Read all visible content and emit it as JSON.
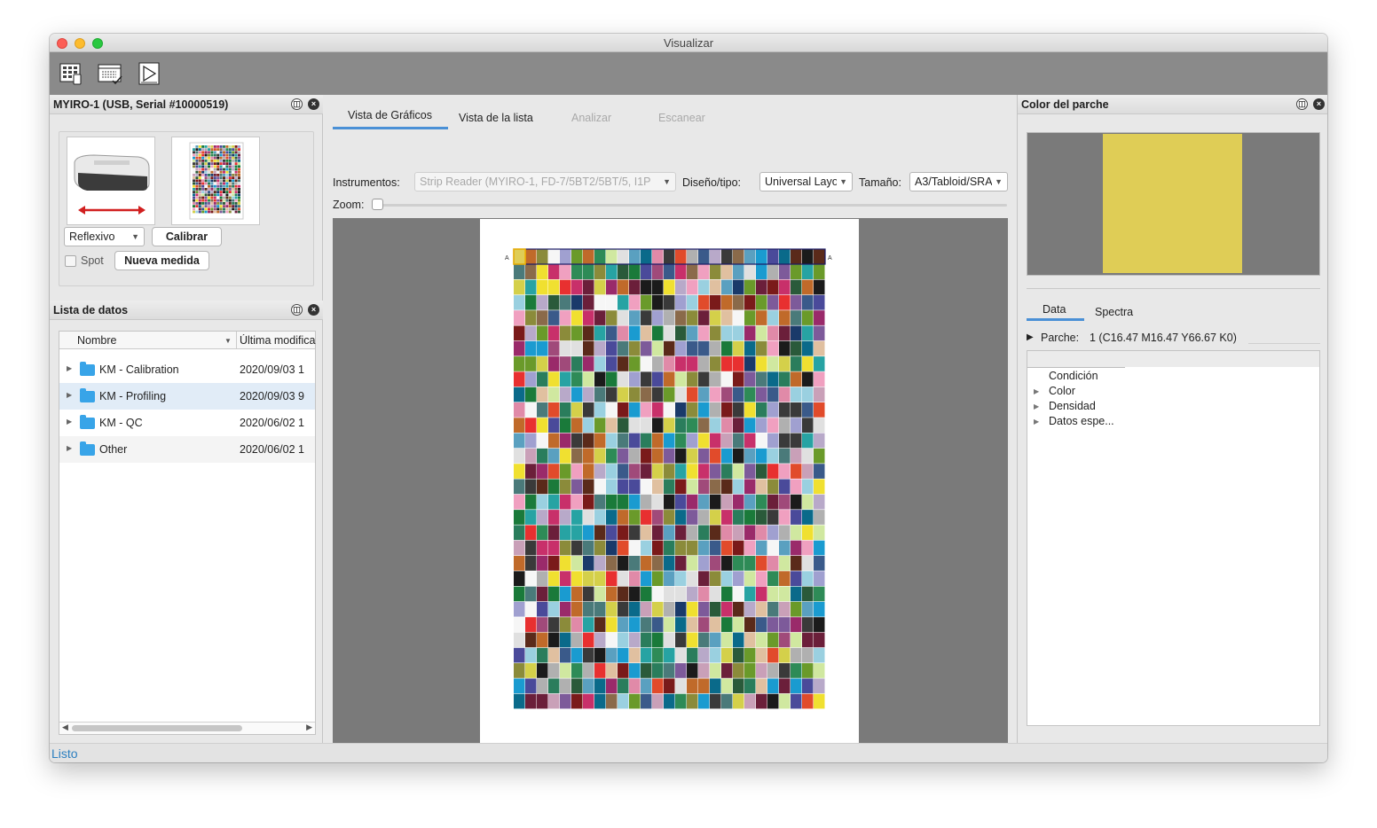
{
  "window": {
    "title": "Visualizar"
  },
  "toolbar": {
    "icons": [
      "chart-grid-icon",
      "list-view-icon",
      "play-chart-icon"
    ]
  },
  "instrument_panel": {
    "header": "MYIRO-1 (USB, Serial #10000519)",
    "mode_select": "Reflexivo",
    "calibrate_label": "Calibrar",
    "spot_label": "Spot",
    "new_measure_label": "Nueva medida"
  },
  "data_list": {
    "header": "Lista de datos",
    "columns": [
      "Nombre",
      "Última modifica"
    ],
    "rows": [
      {
        "name": "KM - Calibration",
        "date": "2020/09/03 1"
      },
      {
        "name": "KM - Profiling",
        "date": "2020/09/03 9"
      },
      {
        "name": "KM - QC",
        "date": "2020/06/02 1"
      },
      {
        "name": "Other",
        "date": "2020/06/02 1"
      }
    ]
  },
  "center": {
    "tabs": [
      "Vista de Gráficos",
      "Vista de la lista",
      "Analizar",
      "Escanear"
    ],
    "active_tab": "Vista de Gráficos",
    "instruments_label": "Instrumentos:",
    "instruments_value": "Strip Reader (MYIRO-1, FD-7/5BT2/5BT/5, I1P",
    "layout_label": "Diseño/tipo:",
    "layout_value": "Universal Layout",
    "size_label": "Tamaño:",
    "size_value": "A3/Tabloid/SRA",
    "zoom_label": "Zoom:",
    "row_marker": "A"
  },
  "patch_panel": {
    "header": "Color del parche",
    "swatch_color": "#dfcd56",
    "tabs": [
      "Data",
      "Spectra"
    ],
    "patch_label": "Parche:",
    "patch_value": "1 (C16.47 M16.47 Y66.67 K0)",
    "tree": [
      "Condición",
      "Color",
      "Densidad",
      "Datos espe..."
    ]
  },
  "status": {
    "text": "Listo"
  },
  "colors": {
    "accent": "#2b7fc0",
    "folder": "#38a4e8",
    "toolbar_bg": "#8a8a8a"
  }
}
